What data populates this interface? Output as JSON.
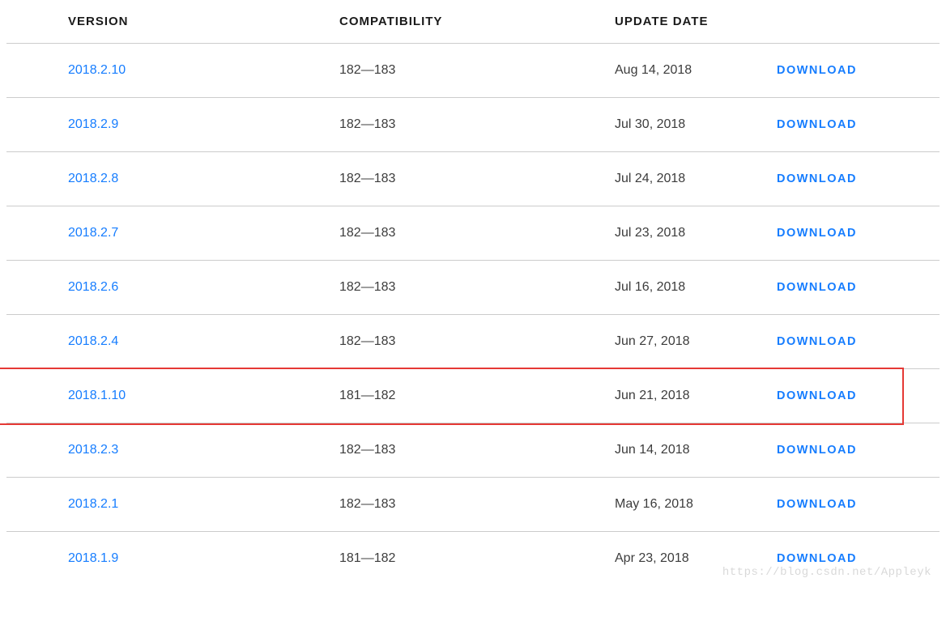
{
  "headers": {
    "version": "VERSION",
    "compatibility": "COMPATIBILITY",
    "update_date": "UPDATE DATE"
  },
  "download_label": "DOWNLOAD",
  "rows": [
    {
      "version": "2018.2.10",
      "compatibility": "182—183",
      "date": "Aug 14, 2018"
    },
    {
      "version": "2018.2.9",
      "compatibility": "182—183",
      "date": "Jul 30, 2018"
    },
    {
      "version": "2018.2.8",
      "compatibility": "182—183",
      "date": "Jul 24, 2018"
    },
    {
      "version": "2018.2.7",
      "compatibility": "182—183",
      "date": "Jul 23, 2018"
    },
    {
      "version": "2018.2.6",
      "compatibility": "182—183",
      "date": "Jul 16, 2018"
    },
    {
      "version": "2018.2.4",
      "compatibility": "182—183",
      "date": "Jun 27, 2018"
    },
    {
      "version": "2018.1.10",
      "compatibility": "181—182",
      "date": "Jun 21, 2018",
      "highlighted": true
    },
    {
      "version": "2018.2.3",
      "compatibility": "182—183",
      "date": "Jun 14, 2018"
    },
    {
      "version": "2018.2.1",
      "compatibility": "182—183",
      "date": "May 16, 2018"
    },
    {
      "version": "2018.1.9",
      "compatibility": "181—182",
      "date": "Apr 23, 2018"
    }
  ],
  "watermark": "https://blog.csdn.net/Appleyk"
}
